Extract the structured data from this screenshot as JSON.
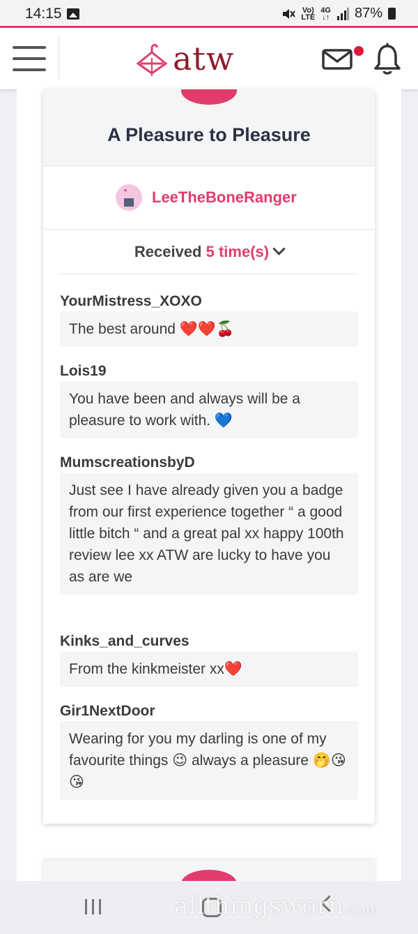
{
  "status_bar": {
    "time": "14:15",
    "net_top": "Vo)",
    "net_bottom": "LTE",
    "gen_top": "4G",
    "gen_bottom": "↓↑",
    "battery": "87%"
  },
  "header": {
    "logo_text": "atw",
    "brand_color": "#8d1e2e",
    "accent_color": "#e23c6c"
  },
  "badge": {
    "title": "A Pleasure to Pleasure",
    "username": "LeeTheBoneRanger",
    "received_label": "Received",
    "received_count": "5 time(s)"
  },
  "reviews": [
    {
      "name": "YourMistress_XOXO",
      "text": "The best around ❤️❤️🍒"
    },
    {
      "name": "Lois19",
      "text": "You have been and always will be a pleasure to work with. 💙"
    },
    {
      "name": "MumscreationsbyD",
      "text": "Just see I have already given you a badge from our first experience together “ a good little bitch “ and a great pal xx happy 100th review lee xx ATW are lucky to have you as are we"
    },
    {
      "name": "Kinks_and_curves",
      "text": "From the kinkmeister xx❤️"
    },
    {
      "name": "Gir1NextDoor",
      "text": "Wearing for you my darling is one of my favourite things 😉 always a pleasure 🤭😘😘"
    }
  ],
  "watermark": {
    "text": "allthingsworn",
    "suffix": ".com"
  }
}
